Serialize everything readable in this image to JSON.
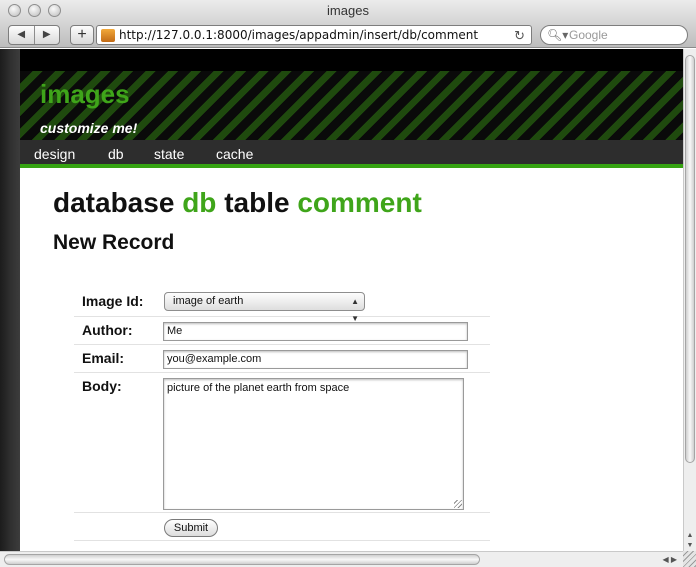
{
  "window": {
    "title": "images"
  },
  "browser": {
    "back_icon": "◀",
    "forward_icon": "▶",
    "add_icon": "+",
    "url": "http://127.0.0.1:8000/images/appadmin/insert/db/comment",
    "reload_icon": "↻",
    "search_icon": "🔍︎▾",
    "search_placeholder": "Google"
  },
  "site": {
    "title": "images",
    "tagline": "customize me!",
    "nav": [
      "design",
      "db",
      "state",
      "cache"
    ],
    "accent_color": "#3fa51a"
  },
  "page": {
    "heading_prefix": "database",
    "db_name": "db",
    "heading_middle": "table",
    "table_name": "comment",
    "subheading": "New Record"
  },
  "form": {
    "image_id_label": "Image Id:",
    "image_id_value": "image of earth",
    "author_label": "Author:",
    "author_value": "Me",
    "email_label": "Email:",
    "email_value": "you@example.com",
    "body_label": "Body:",
    "body_value": "picture of the planet earth from space",
    "submit_label": "Submit"
  }
}
